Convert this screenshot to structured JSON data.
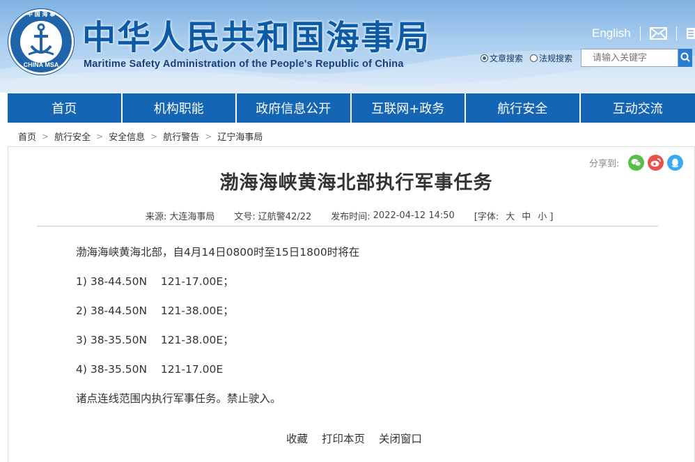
{
  "header": {
    "logo_text": "CHINA MSA",
    "logo_text_top": "中 国 海 事",
    "title": "中华人民共和国海事局",
    "subtitle": "Maritime Safety Administration of the People's Republic of China",
    "english_link": "English",
    "search": {
      "option_article": "文章搜索",
      "option_law": "法规搜索",
      "placeholder": "请输入关键字",
      "selected": "文章搜索"
    }
  },
  "nav": {
    "items": [
      "首页",
      "机构职能",
      "政府信息公开",
      "互联网+政务",
      "航行安全",
      "互动交流"
    ]
  },
  "breadcrumb": [
    "首页",
    "航行安全",
    "安全信息",
    "航行警告",
    "辽宁海事局"
  ],
  "share": {
    "label": "分享到:",
    "targets": [
      "wechat-icon",
      "weibo-icon",
      "qq-icon"
    ]
  },
  "article": {
    "title": "渤海海峡黄海北部执行军事任务",
    "source_label": "来源:",
    "source": "大连海事局",
    "doc_label": "文号:",
    "doc_no": "辽航警42/22",
    "date_label": "发布时间:",
    "date": "2022-04-12 14:50",
    "font_label": "[字体:",
    "font_large": "大",
    "font_medium": "中",
    "font_small": "小 ]",
    "paragraphs": [
      "渤海海峡黄海北部，自4月14日0800时至15日1800时将在",
      "1) 38-44.50N    121-17.00E；",
      "2) 38-44.50N    121-38.00E；",
      "3) 38-35.50N    121-38.00E；",
      "4) 38-35.50N    121-17.00E",
      "诸点连线范围内执行军事任务。禁止驶入。"
    ]
  },
  "actions": {
    "favorite": "收藏",
    "print": "打印本页",
    "close": "关闭窗口"
  },
  "colors": {
    "nav_bg": "#1565b5",
    "title_blue": "#0d5aa7",
    "header_top": "#7fb2e2"
  }
}
